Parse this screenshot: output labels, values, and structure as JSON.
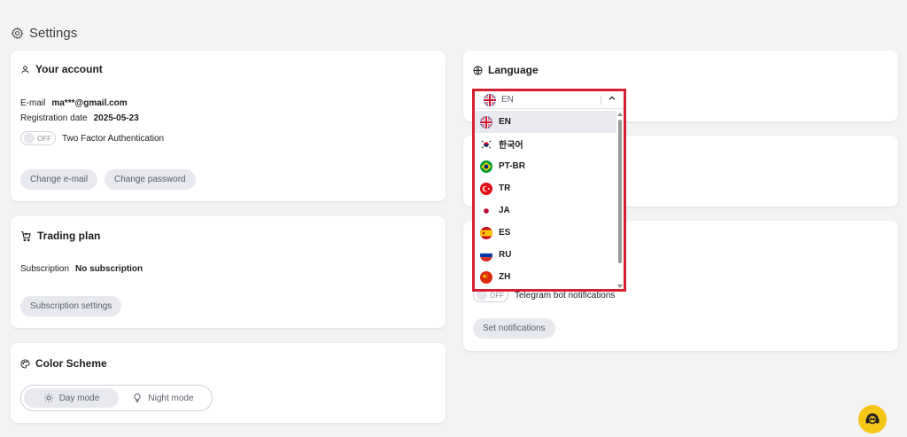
{
  "page": {
    "title": "Settings"
  },
  "account": {
    "title": "Your account",
    "email_label": "E-mail",
    "email_value": "ma***@gmail.com",
    "reg_label": "Registration date",
    "reg_value": "2025-05-23",
    "twofa_state": "OFF",
    "twofa_label": "Two Factor Authentication",
    "change_email": "Change e-mail",
    "change_password": "Change password"
  },
  "trading": {
    "title": "Trading plan",
    "sub_label": "Subscription",
    "sub_value": "No subscription",
    "settings_button": "Subscription settings"
  },
  "color_scheme": {
    "title": "Color Scheme",
    "day": "Day mode",
    "night": "Night mode",
    "selected": "Day mode"
  },
  "language": {
    "title": "Language",
    "selected": "EN",
    "options": [
      {
        "code": "EN",
        "flag": "uk-flag-icon"
      },
      {
        "code": "한국어",
        "flag": "korea-flag-icon"
      },
      {
        "code": "PT-BR",
        "flag": "brazil-flag-icon"
      },
      {
        "code": "TR",
        "flag": "turkey-flag-icon"
      },
      {
        "code": "JA",
        "flag": "japan-flag-icon"
      },
      {
        "code": "ES",
        "flag": "spain-flag-icon"
      },
      {
        "code": "RU",
        "flag": "russia-flag-icon"
      },
      {
        "code": "ZH",
        "flag": "china-flag-icon"
      }
    ]
  },
  "notifications": {
    "telegram_state": "OFF",
    "telegram_label": "Telegram bot notifications",
    "set_button": "Set notifications"
  },
  "colors": {
    "accent": "#d61f30",
    "help": "#f5c518"
  }
}
